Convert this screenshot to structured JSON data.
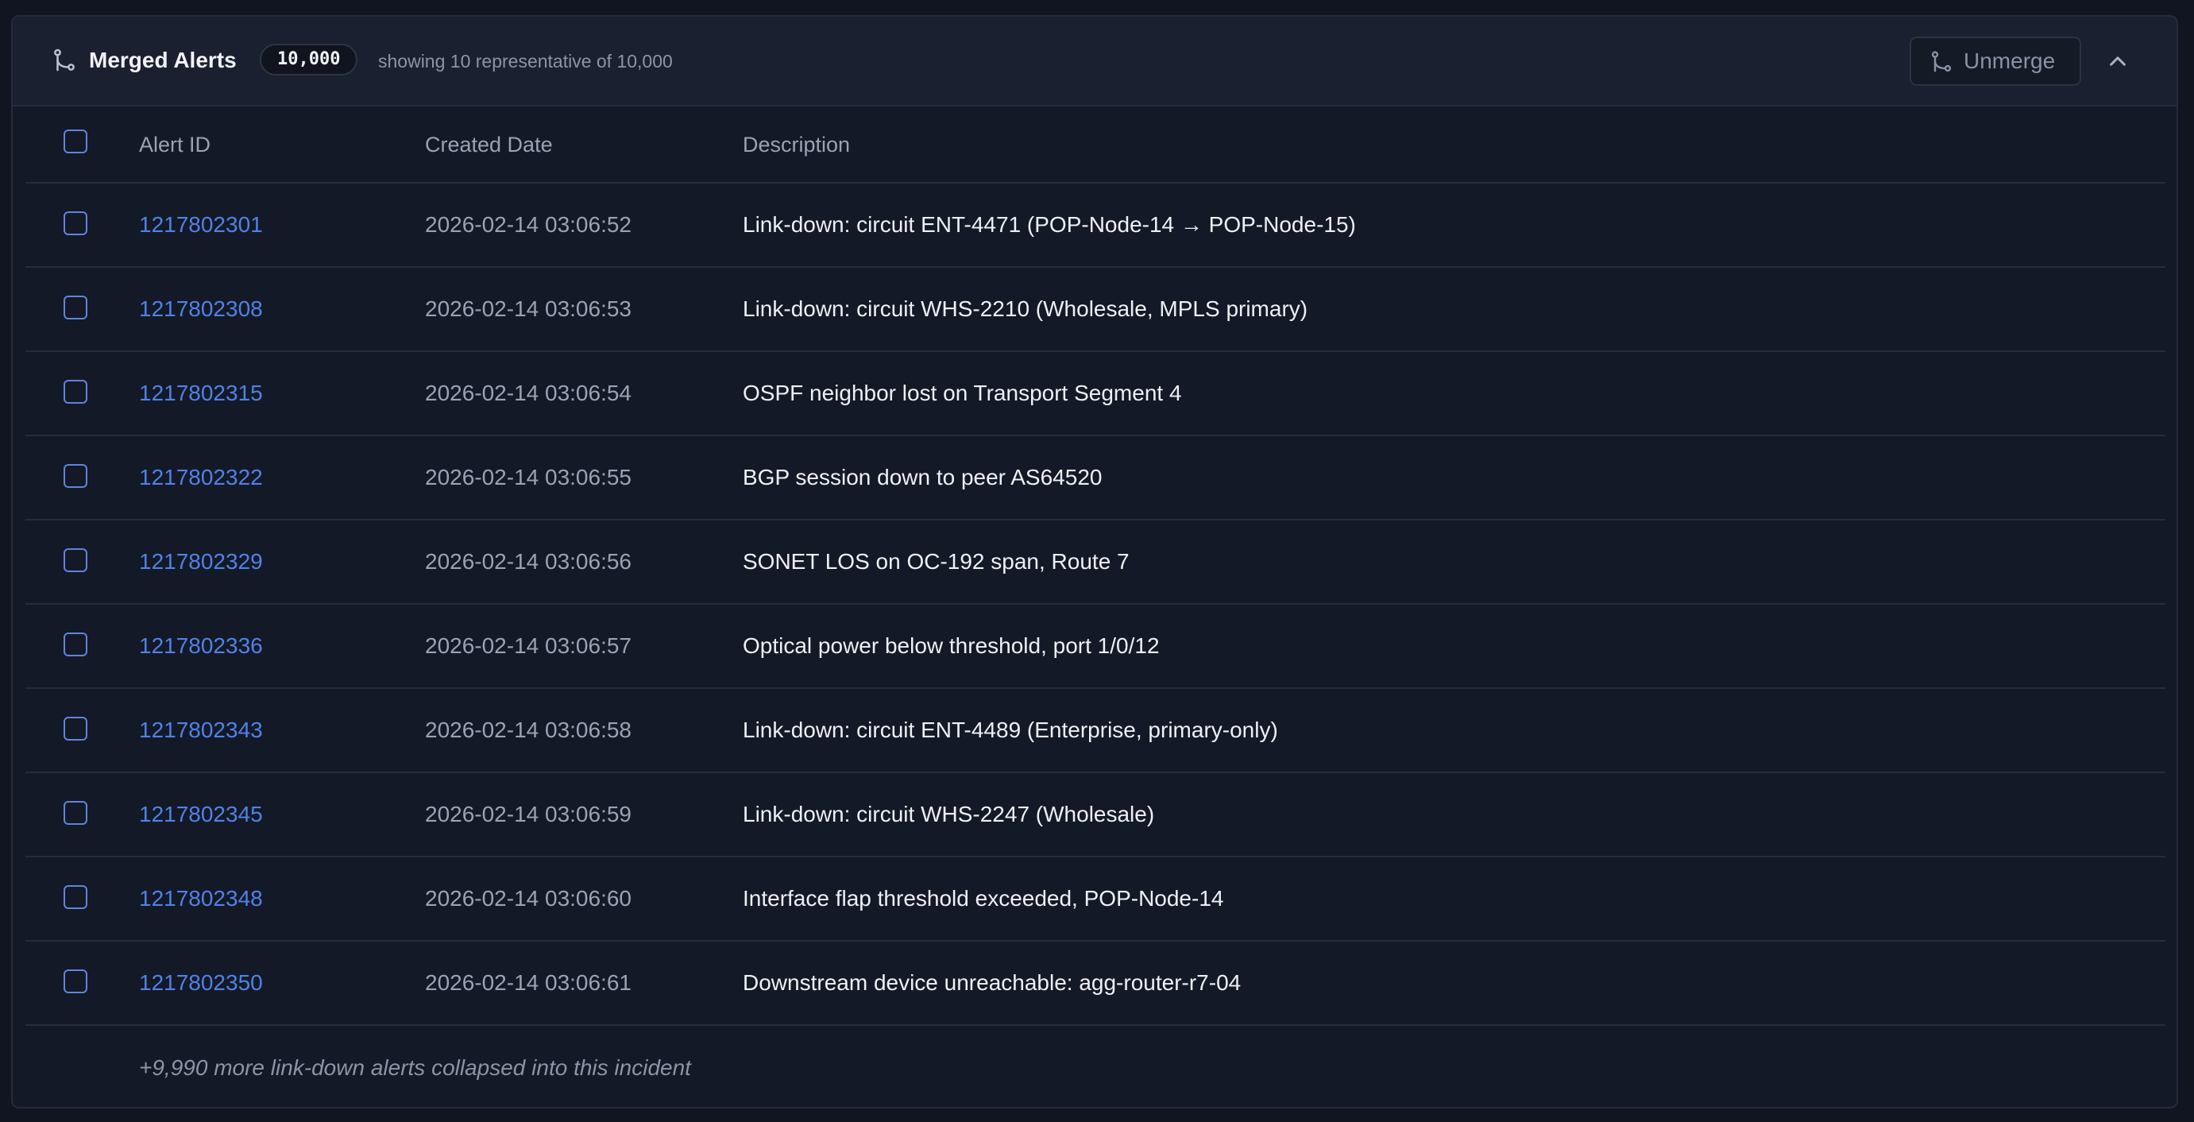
{
  "header": {
    "title": "Merged Alerts",
    "count_badge": "10,000",
    "showing_text": "showing 10 representative of 10,000",
    "unmerge_label": "Unmerge"
  },
  "table": {
    "columns": {
      "alert_id": "Alert ID",
      "created_date": "Created Date",
      "description": "Description"
    },
    "rows": [
      {
        "id": "1217802301",
        "date": "2026-02-14 03:06:52",
        "description": "Link-down: circuit ENT-4471 (POP-Node-14 → POP-Node-15)"
      },
      {
        "id": "1217802308",
        "date": "2026-02-14 03:06:53",
        "description": "Link-down: circuit WHS-2210 (Wholesale, MPLS primary)"
      },
      {
        "id": "1217802315",
        "date": "2026-02-14 03:06:54",
        "description": "OSPF neighbor lost on Transport Segment 4"
      },
      {
        "id": "1217802322",
        "date": "2026-02-14 03:06:55",
        "description": "BGP session down to peer AS64520"
      },
      {
        "id": "1217802329",
        "date": "2026-02-14 03:06:56",
        "description": "SONET LOS on OC-192 span, Route 7"
      },
      {
        "id": "1217802336",
        "date": "2026-02-14 03:06:57",
        "description": "Optical power below threshold, port 1/0/12"
      },
      {
        "id": "1217802343",
        "date": "2026-02-14 03:06:58",
        "description": "Link-down: circuit ENT-4489 (Enterprise, primary-only)"
      },
      {
        "id": "1217802345",
        "date": "2026-02-14 03:06:59",
        "description": "Link-down: circuit WHS-2247 (Wholesale)"
      },
      {
        "id": "1217802348",
        "date": "2026-02-14 03:06:60",
        "description": "Interface flap threshold exceeded, POP-Node-14"
      },
      {
        "id": "1217802350",
        "date": "2026-02-14 03:06:61",
        "description": "Downstream device unreachable: agg-router-r7-04"
      }
    ]
  },
  "footer_note": "+9,990 more link-down alerts collapsed into this incident",
  "colors": {
    "accent_link": "#4f82e6",
    "background": "#141927",
    "header_background": "#1a2030"
  }
}
